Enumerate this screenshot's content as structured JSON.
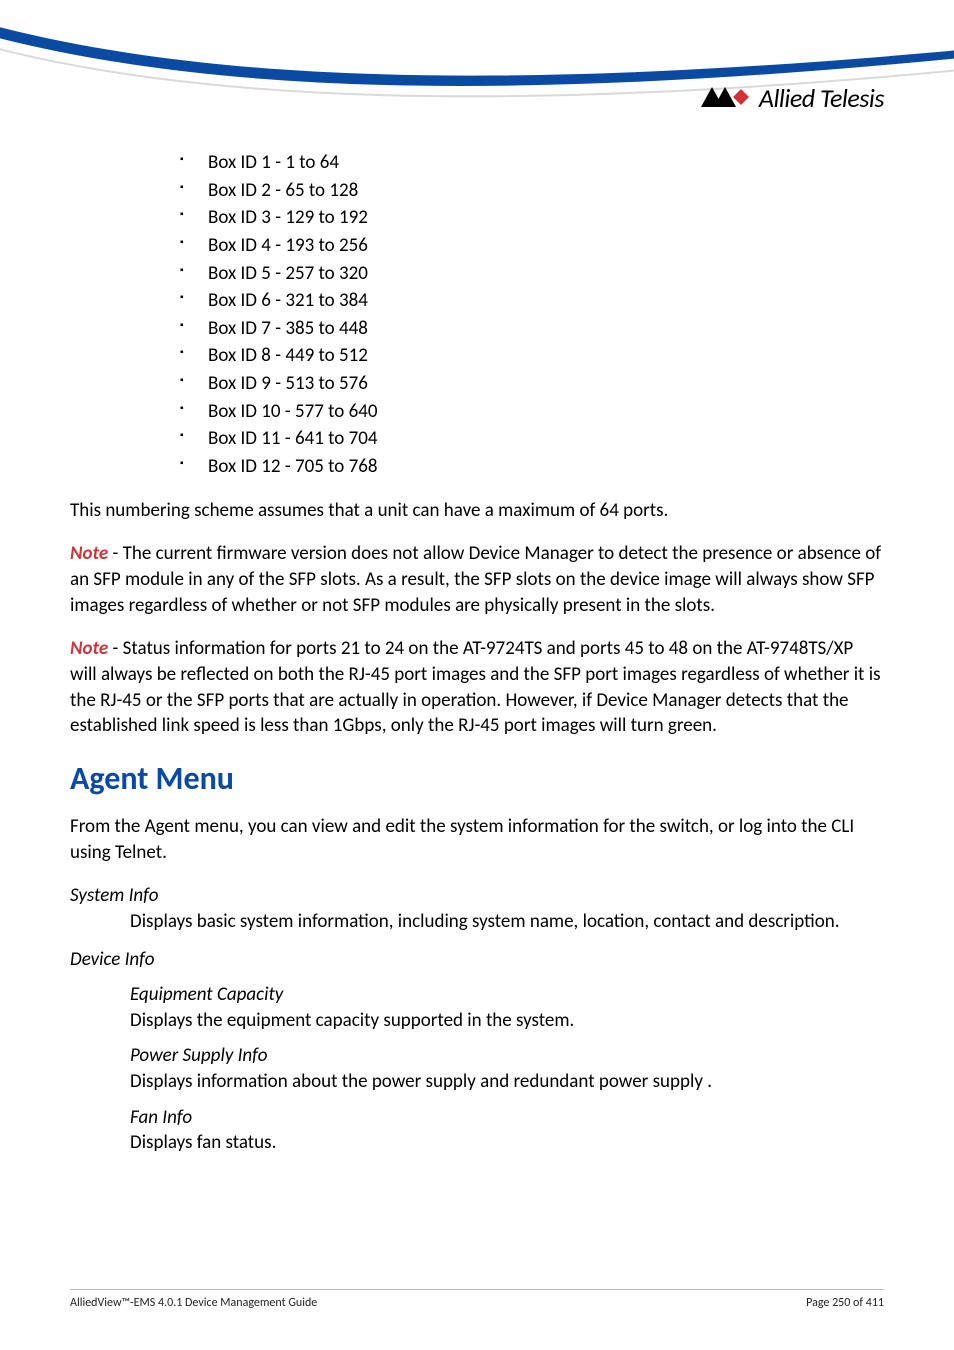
{
  "logo": {
    "brand": "Allied Telesis"
  },
  "box_ids": [
    "Box ID 1 - 1 to 64",
    "Box ID 2 - 65 to 128",
    "Box ID 3 - 129 to 192",
    "Box ID 4 - 193 to 256",
    "Box ID 5 - 257 to 320",
    "Box ID 6 - 321 to 384",
    "Box ID 7 - 385 to 448",
    "Box ID 8 - 449 to 512",
    "Box ID 9 - 513 to 576",
    "Box ID 10 - 577 to 640",
    "Box ID 11 - 641 to 704",
    "Box ID 12 - 705 to 768"
  ],
  "para1": "This numbering scheme assumes that a unit can have a maximum of 64 ports.",
  "note_label": "Note",
  "note1_body": " - The current firmware version does not allow Device Manager to detect the presence or absence of an SFP module in any of the SFP slots. As a result, the SFP slots on the device image will always show SFP images regardless of whether or not SFP modules are physically present in the slots.",
  "note2_body": " - Status information for ports 21 to 24 on the AT-9724TS and ports 45 to 48 on the AT-9748TS/XP will always be reflected on both the RJ-45 port images and the SFP port images regardless of whether it is the RJ-45 or the SFP ports that are actually in operation. However, if Device Manager detects that the established link speed is less than 1Gbps, only the RJ-45 port images will turn green.",
  "section_title": "Agent Menu",
  "section_intro": "From the Agent menu, you can view and edit the system information for the switch, or log into the CLI using Telnet.",
  "defs": {
    "system_info": {
      "term": "System Info",
      "body": "Displays basic system information, including system name, location, contact and description."
    },
    "device_info": {
      "term": "Device Info",
      "equipment_capacity": {
        "term": "Equipment Capacity",
        "body": "Displays the equipment capacity supported in the system."
      },
      "power_supply": {
        "term": "Power Supply Info",
        "body": "Displays information about the power supply and redundant power supply ."
      },
      "fan_info": {
        "term": "Fan Info",
        "body": "Displays fan status."
      }
    }
  },
  "footer": {
    "left": "AlliedView™-EMS 4.0.1 Device Management Guide",
    "right": "Page 250 of 411"
  }
}
